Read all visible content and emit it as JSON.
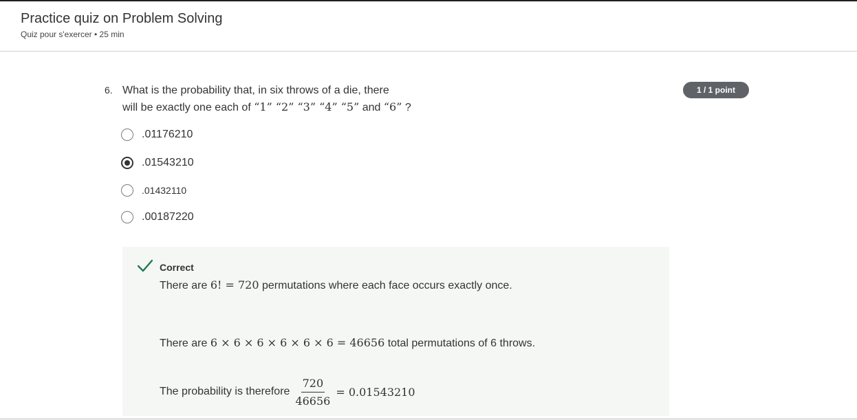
{
  "header": {
    "title": "Practice quiz on Problem Solving",
    "subtitle": "Quiz pour s'exercer • 25 min"
  },
  "question": {
    "number": "6.",
    "line1": "What is the probability that, in six throws of a die, there",
    "line2_prefix": "will be exactly one each of ",
    "line2_faces": "“1” “2” “3” “4” “5”",
    "line2_and": " and ",
    "line2_last": "“6”",
    "line2_suffix": " ?",
    "points_badge": "1 / 1 point"
  },
  "options": [
    {
      "label": ".01176210",
      "selected": false
    },
    {
      "label": ".01543210",
      "selected": true
    },
    {
      "label": ".01432110",
      "selected": false
    },
    {
      "label": ".00187220",
      "selected": false
    }
  ],
  "feedback": {
    "status": "Correct",
    "check_color": "#1e7b4d",
    "line1_pre": "There are ",
    "line1_math": "6! = 720",
    "line1_post": " permutations where each face occurs exactly once.",
    "line2_pre": "There are ",
    "line2_math": "6 × 6 × 6 × 6 × 6 × 6 = 46656",
    "line2_post": " total permutations of 6 throws.",
    "line3_pre": "The probability is therefore",
    "frac_num": "720",
    "frac_den": "46656",
    "result": "= 0.01543210"
  }
}
